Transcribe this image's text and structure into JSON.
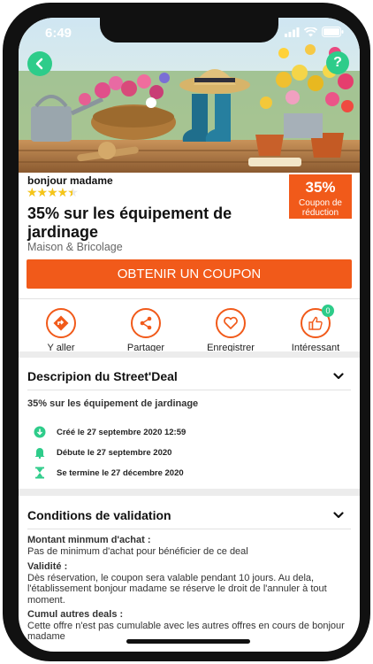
{
  "status": {
    "time": "6:49"
  },
  "deal": {
    "shop_name": "bonjour madame",
    "rating": 4.5,
    "rating_stars": "★★★★★",
    "badge_percent": "35%",
    "badge_label_1": "Coupon de",
    "badge_label_2": "réduction",
    "title": "35% sur les équipement de jardinage",
    "category": "Maison & Bricolage",
    "cta_label": "OBTENIR UN COUPON"
  },
  "actions": [
    {
      "label": "Y aller",
      "icon": "directions-icon"
    },
    {
      "label": "Partager",
      "icon": "share-icon"
    },
    {
      "label": "Enregistrer",
      "icon": "heart-icon"
    },
    {
      "label": "Intéressant",
      "icon": "thumbs-up-icon",
      "count": "0"
    }
  ],
  "description": {
    "title": "Descripion du Street'Deal",
    "text": "35% sur les équipement de jardinage",
    "created": "Créé le 27 septembre 2020 12:59",
    "starts": "Débute le  27 septembre 2020",
    "ends": "Se termine le  27 décembre 2020"
  },
  "conditions": {
    "title": "Conditions de validation",
    "items": [
      {
        "heading": "Montant minmum d'achat :",
        "text": "Pas de minimum d'achat pour bénéficier de ce deal"
      },
      {
        "heading": "Validité :",
        "text": "Dès réservation, le coupon sera valable pendant 10 jours. Au dela, l'établissement bonjour madame se réserve le droit de l'annuler à tout moment."
      },
      {
        "heading": "Cumul autres deals :",
        "text": "Cette offre n'est pas cumulable avec les autres offres en cours de bonjour madame"
      }
    ]
  },
  "colors": {
    "accent": "#f15a1a",
    "green": "#2ecc8a",
    "star": "#f5c518"
  }
}
